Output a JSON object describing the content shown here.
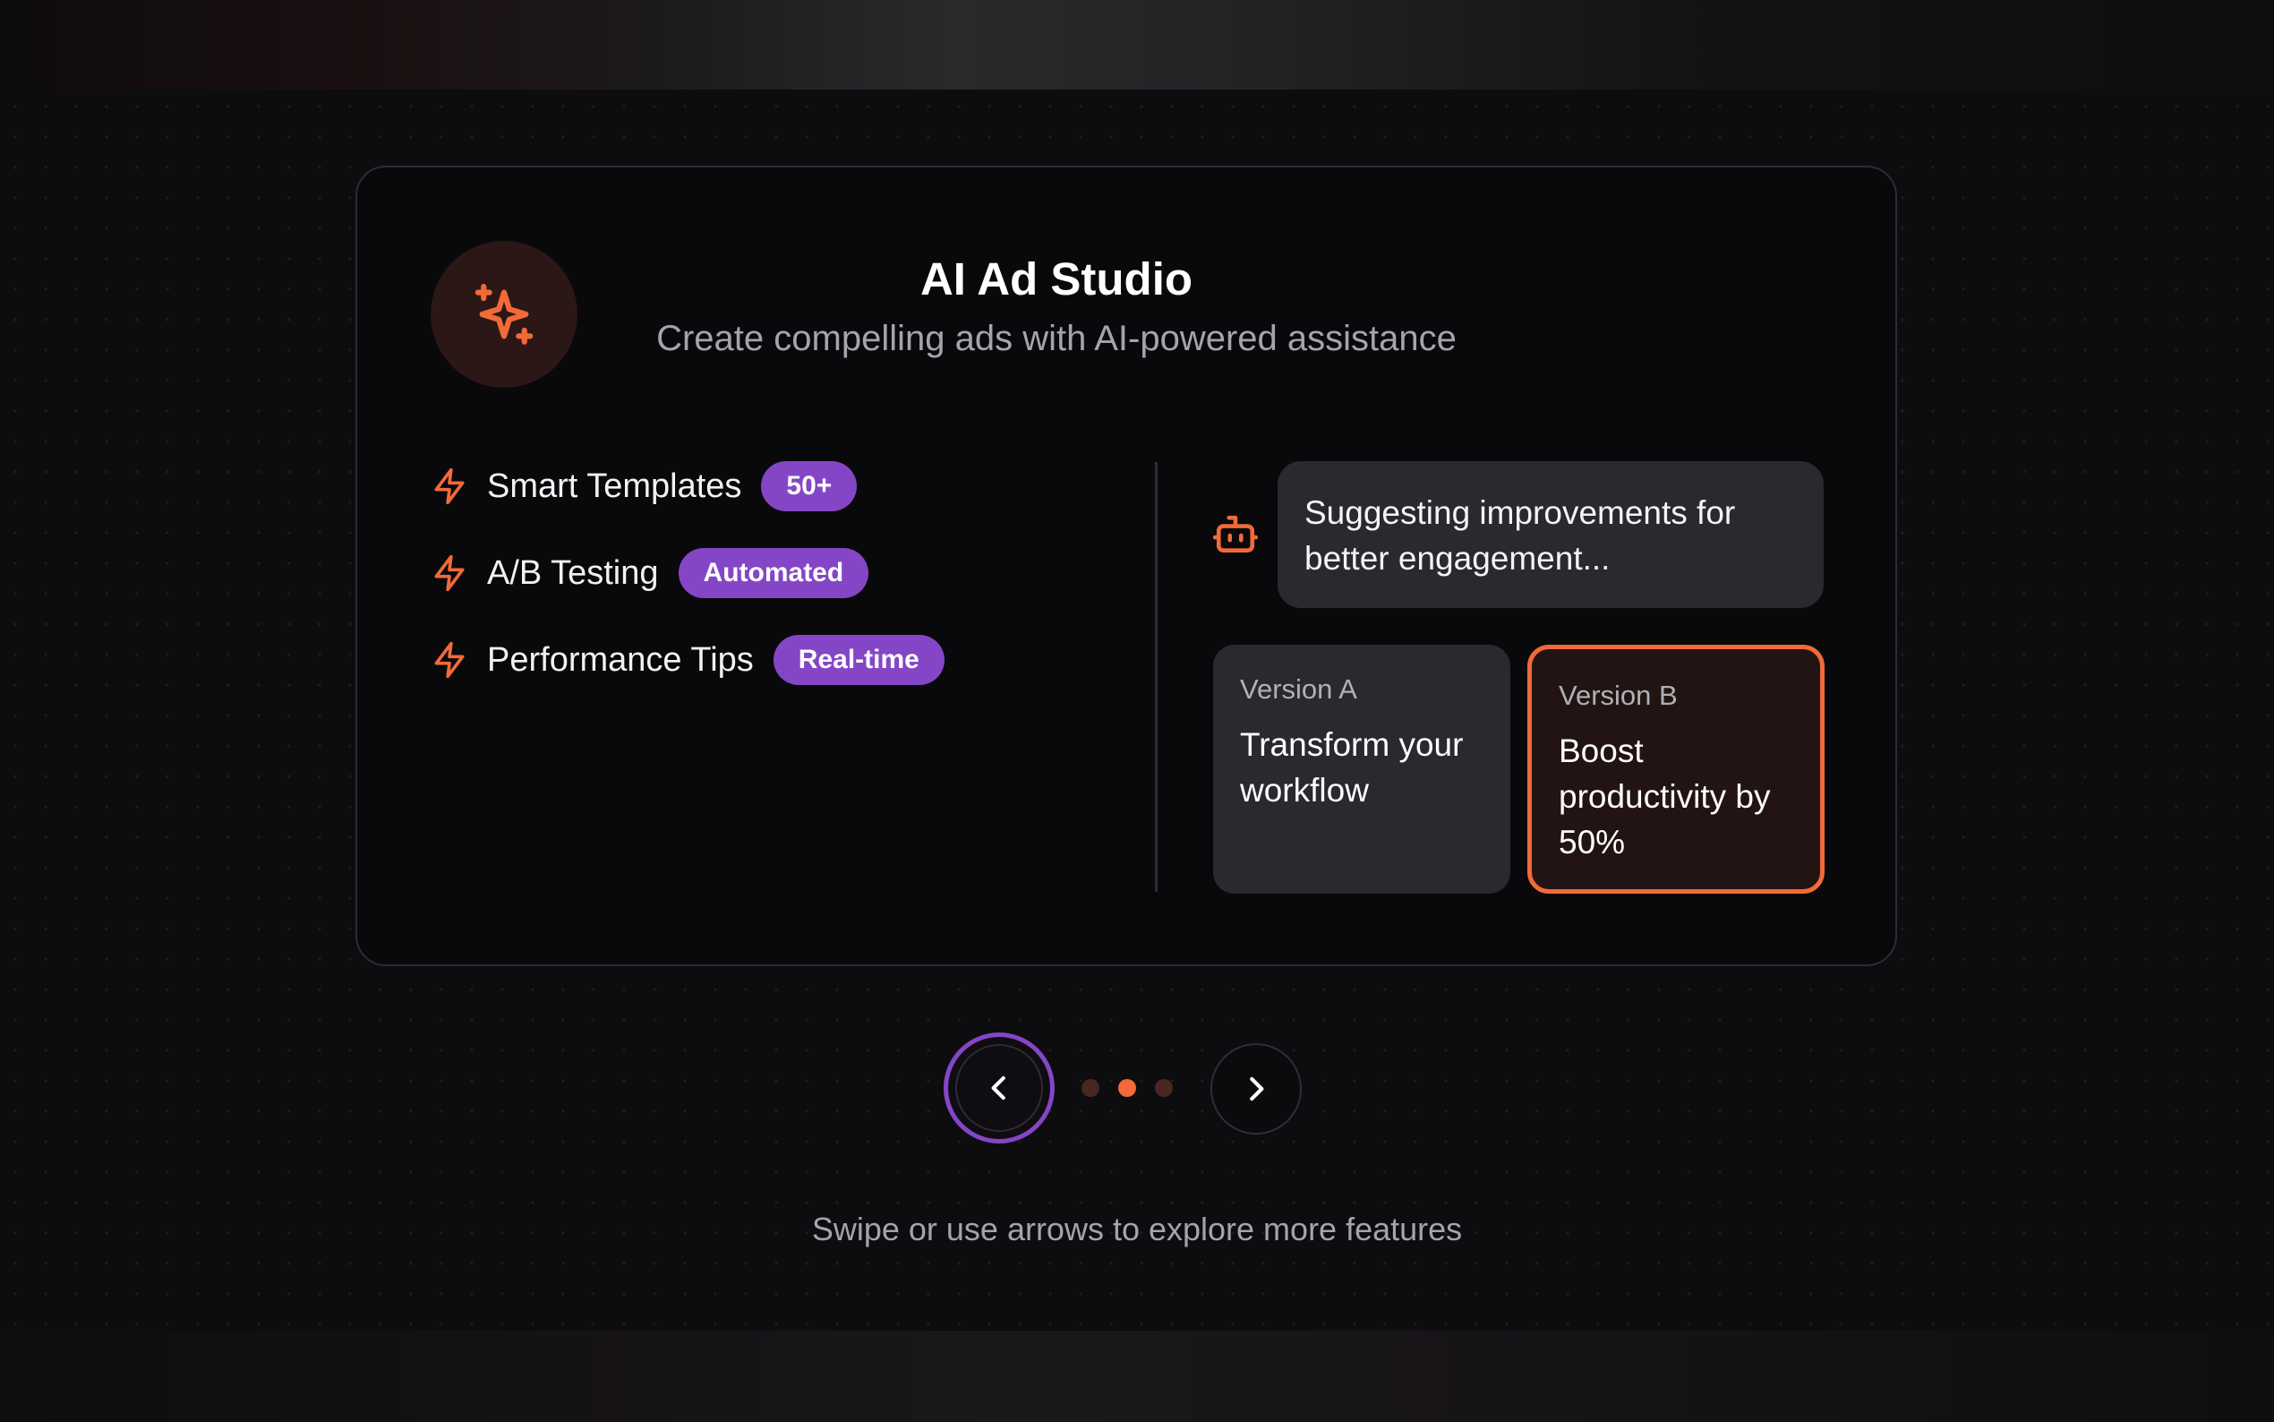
{
  "hero": {
    "icon": "sparkles-icon",
    "title": "AI Ad Studio",
    "subtitle": "Create compelling ads with AI-powered assistance"
  },
  "features": [
    {
      "icon": "lightning-icon",
      "label": "Smart Templates",
      "badge": "50+"
    },
    {
      "icon": "lightning-icon",
      "label": "A/B Testing",
      "badge": "Automated"
    },
    {
      "icon": "lightning-icon",
      "label": "Performance Tips",
      "badge": "Real-time"
    }
  ],
  "assistant": {
    "icon": "bot-icon",
    "message": "Suggesting improvements for better engagement..."
  },
  "versions": [
    {
      "name": "Version A",
      "text": "Transform your workflow",
      "selected": false
    },
    {
      "name": "Version B",
      "text": "Boost productivity by 50%",
      "selected": true
    }
  ],
  "carousel": {
    "prev_icon": "chevron-left-icon",
    "next_icon": "chevron-right-icon",
    "total": 3,
    "active_index": 1
  },
  "hint": "Swipe or use arrows to explore more features",
  "colors": {
    "accent": "#f26a38",
    "badge": "#8446c6",
    "background": "#0d0c0f",
    "card": "#09090c"
  }
}
